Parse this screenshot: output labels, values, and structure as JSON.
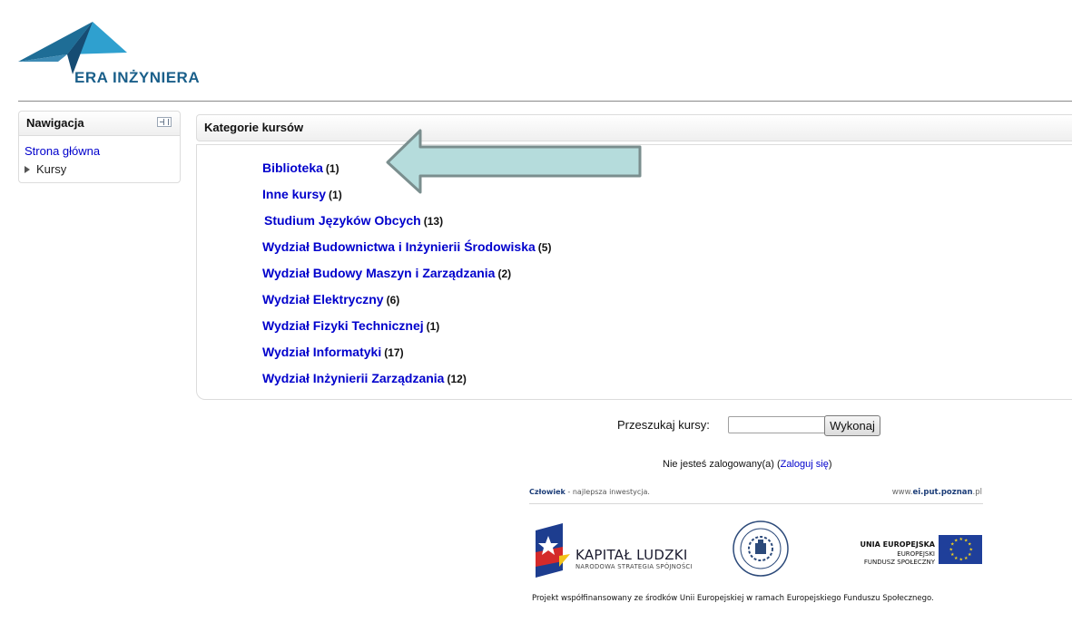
{
  "header": {
    "logo_text": "ERA INŻYNIERA"
  },
  "navigation": {
    "title": "Nawigacja",
    "home_link": "Strona główna",
    "courses_item": "Kursy"
  },
  "categories": {
    "title": "Kategorie kursów",
    "items": [
      {
        "name": "Biblioteka",
        "count": "(1)"
      },
      {
        "name": "Inne kursy",
        "count": "(1)"
      },
      {
        "name": "Studium Języków Obcych",
        "count": "(13)"
      },
      {
        "name": "Wydział Budownictwa i Inżynierii Środowiska",
        "count": "(5)"
      },
      {
        "name": "Wydział Budowy Maszyn i Zarządzania",
        "count": "(2)"
      },
      {
        "name": "Wydział Elektryczny",
        "count": "(6)"
      },
      {
        "name": "Wydział Fizyki Technicznej",
        "count": "(1)"
      },
      {
        "name": "Wydział Informatyki",
        "count": "(17)"
      },
      {
        "name": "Wydział Inżynierii Zarządzania",
        "count": "(12)"
      }
    ]
  },
  "search": {
    "label": "Przeszukaj kursy:",
    "value": "",
    "button": "Wykonaj"
  },
  "login": {
    "prefix": "Nie jesteś zalogowany(a) (",
    "link": "Zaloguj się",
    "suffix": ")"
  },
  "banner": {
    "top_left_bold": "Człowiek",
    "top_left_rest": " - najlepsza inwestycja.",
    "top_right_pre": "www.",
    "top_right_bold": "ei.put.poznan",
    "top_right_post": ".pl",
    "kl_title": "KAPITAŁ LUDZKI",
    "kl_sub": "NARODOWA STRATEGIA SPÓJNOŚCI",
    "ue_title": "UNIA EUROPEJSKA",
    "ue_sub1": "EUROPEJSKI",
    "ue_sub2": "FUNDUSZ SPOŁECZNY",
    "footer": "Projekt współfinansowany ze środków Unii Europejskiej w ramach Europejskiego Funduszu Społecznego."
  },
  "colors": {
    "link": "#0000cc",
    "arrow_fill": "#b5dcdc",
    "arrow_stroke": "#7a8e8e"
  }
}
